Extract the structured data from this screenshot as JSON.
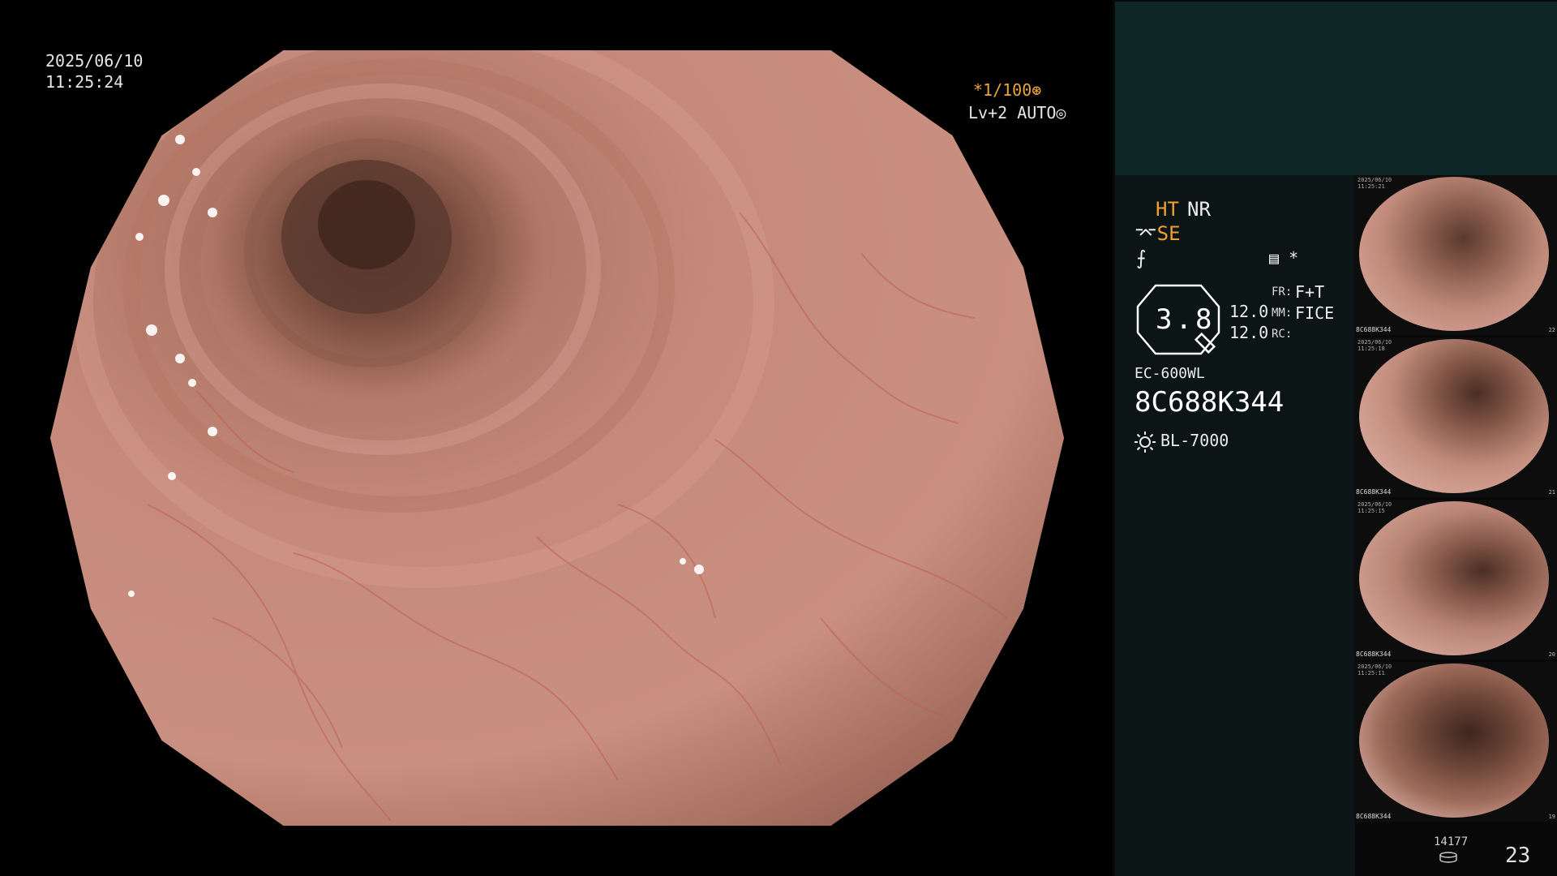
{
  "overlay": {
    "date": "2025/06/10",
    "time": "11:25:24",
    "shutter": "*1/100",
    "level": "Lv+2 AUTO"
  },
  "settings": {
    "ht": "HT",
    "nr": "NR",
    "se": "SE",
    "memo_star": "*",
    "zoom": "3.8",
    "r1": "12.0",
    "r2": "12.0",
    "fr_label": "FR:",
    "fr_value": "F+T",
    "mm_label": "MM:",
    "mm_value": "FICE",
    "rc_label": "RC:"
  },
  "scope": {
    "model": "EC-600WL",
    "serial": "8C688K344",
    "light_source": "BL-7000"
  },
  "thumbnails": [
    {
      "date": "2025/06/10",
      "time": "11:25:21",
      "serial": "8C688K344",
      "index": "22"
    },
    {
      "date": "2025/06/10",
      "time": "11:25:18",
      "serial": "8C688K344",
      "index": "21"
    },
    {
      "date": "2025/06/10",
      "time": "11:25:15",
      "serial": "8C688K344",
      "index": "20"
    },
    {
      "date": "2025/06/10",
      "time": "11:25:11",
      "serial": "8C688K344",
      "index": "19"
    }
  ],
  "footer": {
    "image_count": "14177",
    "frame_number": "23"
  },
  "colors": {
    "accent_orange": "#f0a030",
    "panel_teal": "#0f2627",
    "panel_dark": "#0b1516"
  }
}
